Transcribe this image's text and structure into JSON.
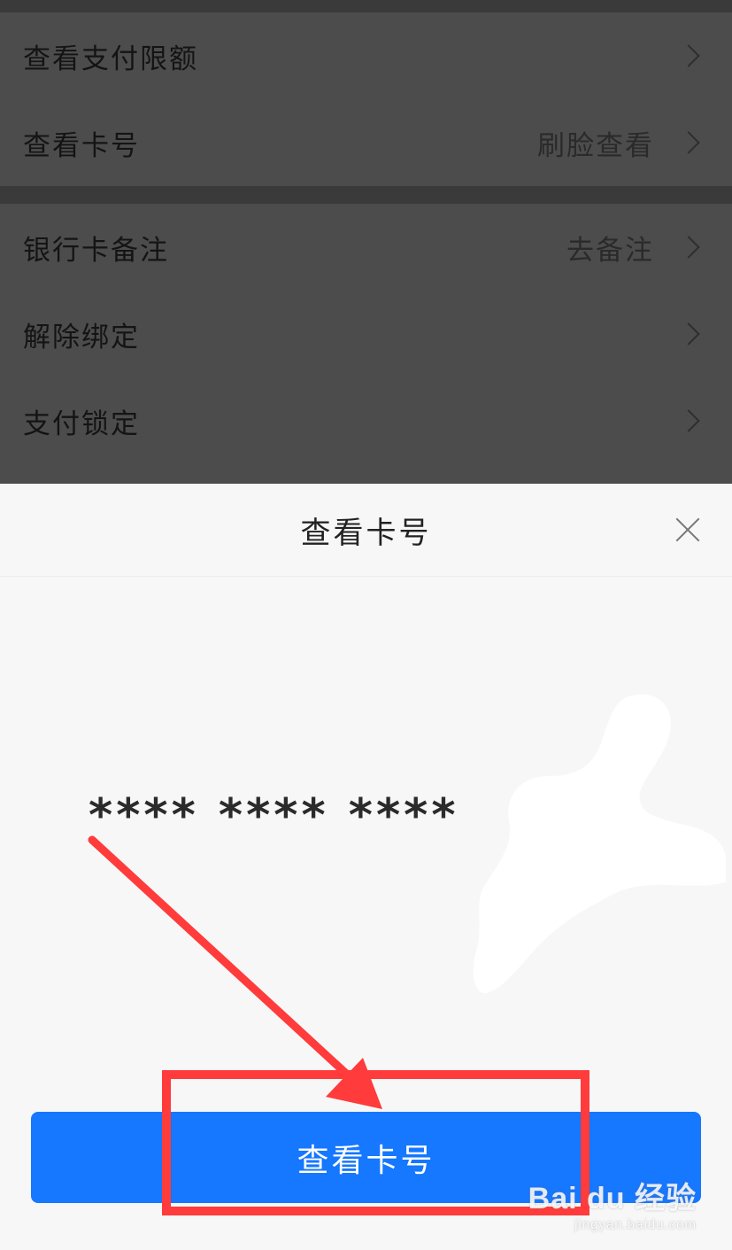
{
  "settings": {
    "group1": [
      {
        "label": "查看支付限额",
        "value": ""
      },
      {
        "label": "查看卡号",
        "value": "刷脸查看"
      }
    ],
    "group2": [
      {
        "label": "银行卡备注",
        "value": "去备注"
      },
      {
        "label": "解除绑定",
        "value": ""
      },
      {
        "label": "支付锁定",
        "value": ""
      }
    ]
  },
  "sheet": {
    "title": "查看卡号",
    "card_number": "**** **** ****",
    "button_label": "查看卡号"
  },
  "colors": {
    "primary_button": "#1677ff",
    "annotation": "#ff3b3b"
  },
  "watermark": {
    "main": "Bai du 经验",
    "sub": "jingyan.baidu.com"
  }
}
